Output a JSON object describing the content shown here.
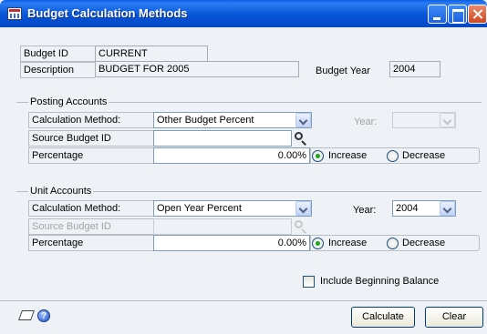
{
  "window": {
    "title": "Budget Calculation Methods"
  },
  "budget": {
    "id_label": "Budget ID",
    "id_value": "CURRENT",
    "description_label": "Description",
    "description_value": "BUDGET FOR 2005",
    "year_label": "Budget Year",
    "year_value": "2004"
  },
  "posting": {
    "group_title": "Posting Accounts",
    "method_label": "Calculation Method:",
    "method_value": "Other Budget Percent",
    "year_label": "Year:",
    "year_value": "",
    "source_label": "Source Budget ID",
    "source_value": "",
    "percentage_label": "Percentage",
    "percentage_value": "0.00%",
    "increase_label": "Increase",
    "decrease_label": "Decrease",
    "selected": "Increase"
  },
  "unit": {
    "group_title": "Unit Accounts",
    "method_label": "Calculation Method:",
    "method_value": "Open Year Percent",
    "year_label": "Year:",
    "year_value": "2004",
    "source_label": "Source Budget ID",
    "source_value": "",
    "percentage_label": "Percentage",
    "percentage_value": "0.00%",
    "increase_label": "Increase",
    "decrease_label": "Decrease",
    "selected": "Increase"
  },
  "include_beginning_balance": {
    "label": "Include Beginning Balance",
    "checked": false
  },
  "buttons": {
    "calculate": "Calculate",
    "clear": "Clear"
  },
  "icons": {
    "note": "note-icon",
    "help": "help-icon"
  },
  "colors": {
    "titlebar": "#0754d8",
    "background": "#eef1f6",
    "radio_checked": "#21a121"
  }
}
